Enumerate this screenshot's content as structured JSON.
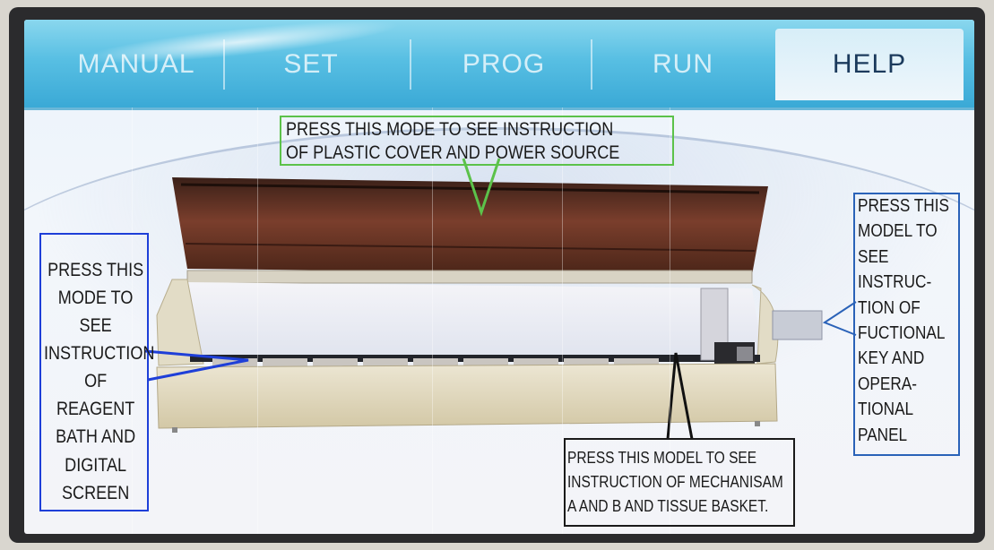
{
  "tabs": [
    {
      "label": "MANUAL"
    },
    {
      "label": "SET"
    },
    {
      "label": "PROG"
    },
    {
      "label": "RUN"
    },
    {
      "label": "HELP"
    }
  ],
  "active_tab": "HELP",
  "callouts": {
    "cover": "PRESS THIS MODE TO SEE INSTRUCTION\nOF PLASTIC COVER AND POWER SOURCE",
    "reagent": "PRESS THIS\nMODE TO SEE\nINSTRUCTION\nOF REAGENT\nBATH AND\nDIGITAL\nSCREEN",
    "panel": "PRESS THIS\nMODEL TO\nSEE\nINSTRUC-\nTION OF\nFUCTIONAL\nKEY AND\nOPERA-\nTIONAL\nPANEL",
    "mechanism": "PRESS THIS MODEL TO SEE\nINSTRUCTION OF MECHANISAM\nA AND B AND TISSUE BASKET."
  },
  "colors": {
    "tab_bar": "#3aa9d6",
    "active_tab_text": "#1b3a5c",
    "cover_box": "#5cc24a",
    "reagent_box": "#1e3fd8",
    "panel_box": "#2a62b8",
    "mechanism_box": "#1a1a1a"
  },
  "icons": {
    "device": "tissue-processor-illustration"
  }
}
